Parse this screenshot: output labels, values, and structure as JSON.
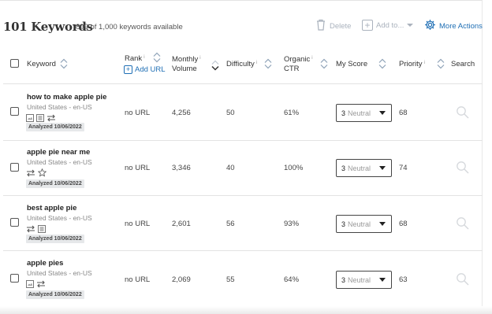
{
  "header": {
    "title": "101 Keywords",
    "available": "899 of 1,000 keywords available",
    "delete_label": "Delete",
    "add_to_label": "Add to...",
    "more_actions_label": "More Actions",
    "accent_color": "#1f6fb5",
    "icons": {
      "delete": "trash-icon",
      "add_to": "plus-box-icon",
      "more": "gear-icon"
    }
  },
  "columns": {
    "keyword": "Keyword",
    "rank": "Rank",
    "add_url": "Add URL",
    "monthly_volume_1": "Monthly",
    "monthly_volume_2": "Volume",
    "difficulty": "Difficulty",
    "organic_ctr_1": "Organic",
    "organic_ctr_2": "CTR",
    "my_score": "My Score",
    "priority": "Priority",
    "search": "Search",
    "info_mark": "i"
  },
  "rows": [
    {
      "keyword": "how to make apple pie",
      "location": "United States - en-US",
      "features": [
        "serp-feature-icon",
        "serp-feature-icon",
        "swap-icon"
      ],
      "analyzed": "Analyzed 10/06/2022",
      "rank": "no URL",
      "volume": "4,256",
      "difficulty": "50",
      "ctr": "61%",
      "score_num": "3",
      "score_label": "Neutral",
      "priority": "68"
    },
    {
      "keyword": "apple pie near me",
      "location": "United States - en-US",
      "features": [
        "swap-icon",
        "star-icon"
      ],
      "analyzed": "Analyzed 10/06/2022",
      "rank": "no URL",
      "volume": "3,346",
      "difficulty": "40",
      "ctr": "100%",
      "score_num": "3",
      "score_label": "Neutral",
      "priority": "74"
    },
    {
      "keyword": "best apple pie",
      "location": "United States - en-US",
      "features": [
        "swap-icon",
        "serp-feature-icon"
      ],
      "analyzed": "Analyzed 10/06/2022",
      "rank": "no URL",
      "volume": "2,601",
      "difficulty": "56",
      "ctr": "93%",
      "score_num": "3",
      "score_label": "Neutral",
      "priority": "68"
    },
    {
      "keyword": "apple pies",
      "location": "United States - en-US",
      "features": [
        "serp-feature-icon",
        "swap-icon"
      ],
      "analyzed": "Analyzed 10/06/2022",
      "rank": "no URL",
      "volume": "2,069",
      "difficulty": "55",
      "ctr": "64%",
      "score_num": "3",
      "score_label": "Neutral",
      "priority": "63"
    }
  ]
}
